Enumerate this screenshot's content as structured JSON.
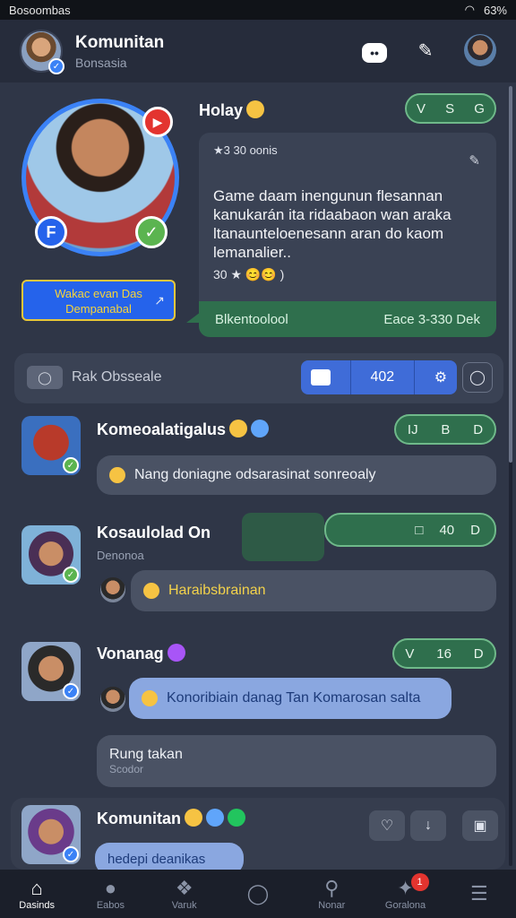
{
  "statusbar": {
    "left": "Bosoombas",
    "battery": "63%"
  },
  "header": {
    "title": "Komunitan",
    "subtitle": "Bonsasia"
  },
  "profile": {
    "name": "Holay",
    "pill_icons": [
      "V",
      "S",
      "G"
    ],
    "yellow_button": "Wakac evan Das Dempanabal",
    "card": {
      "meta": "★3 30 oonis",
      "body": "Game daam inengunun flesannan kanukarán ita ridaabaon wan araka ltanaunteloenesann aran do kaom lemanalier..",
      "stats": "30  ★        😊😊 )",
      "footer_left": "Blkentoolool",
      "footer_right": "Eace 3-330 Dek"
    }
  },
  "search": {
    "placeholder": "Rak Obsseale",
    "count": "402"
  },
  "posts": [
    {
      "name": "Komeoalatigalus",
      "pill": [
        "IJ",
        "B",
        "D"
      ],
      "message": "Nang doniagne odsarasinat sonreoaly"
    },
    {
      "name": "Kosaulolad On",
      "sub": "Denonoa",
      "pill": [
        "□",
        "40",
        "D"
      ],
      "message": "Haraibsbrainan"
    },
    {
      "name": "Vonanag",
      "pill": [
        "V",
        "16",
        "D"
      ],
      "message": "Konoribiain danag Tan Komarosan salta",
      "input": "Rung takan",
      "input_sub": "Scodor"
    },
    {
      "name": "Komunitan",
      "message": "hedepi deanikas"
    }
  ],
  "nav": [
    {
      "label": "Dasinds",
      "icon": "home-icon"
    },
    {
      "label": "Eabos",
      "icon": "people-icon"
    },
    {
      "label": "Varuk",
      "icon": "group-icon"
    },
    {
      "label": "",
      "icon": "circle-icon"
    },
    {
      "label": "Nonar",
      "icon": "search-icon"
    },
    {
      "label": "Goralona",
      "icon": "compass-icon",
      "badge": "1"
    },
    {
      "label": "",
      "icon": "menu-icon"
    }
  ]
}
